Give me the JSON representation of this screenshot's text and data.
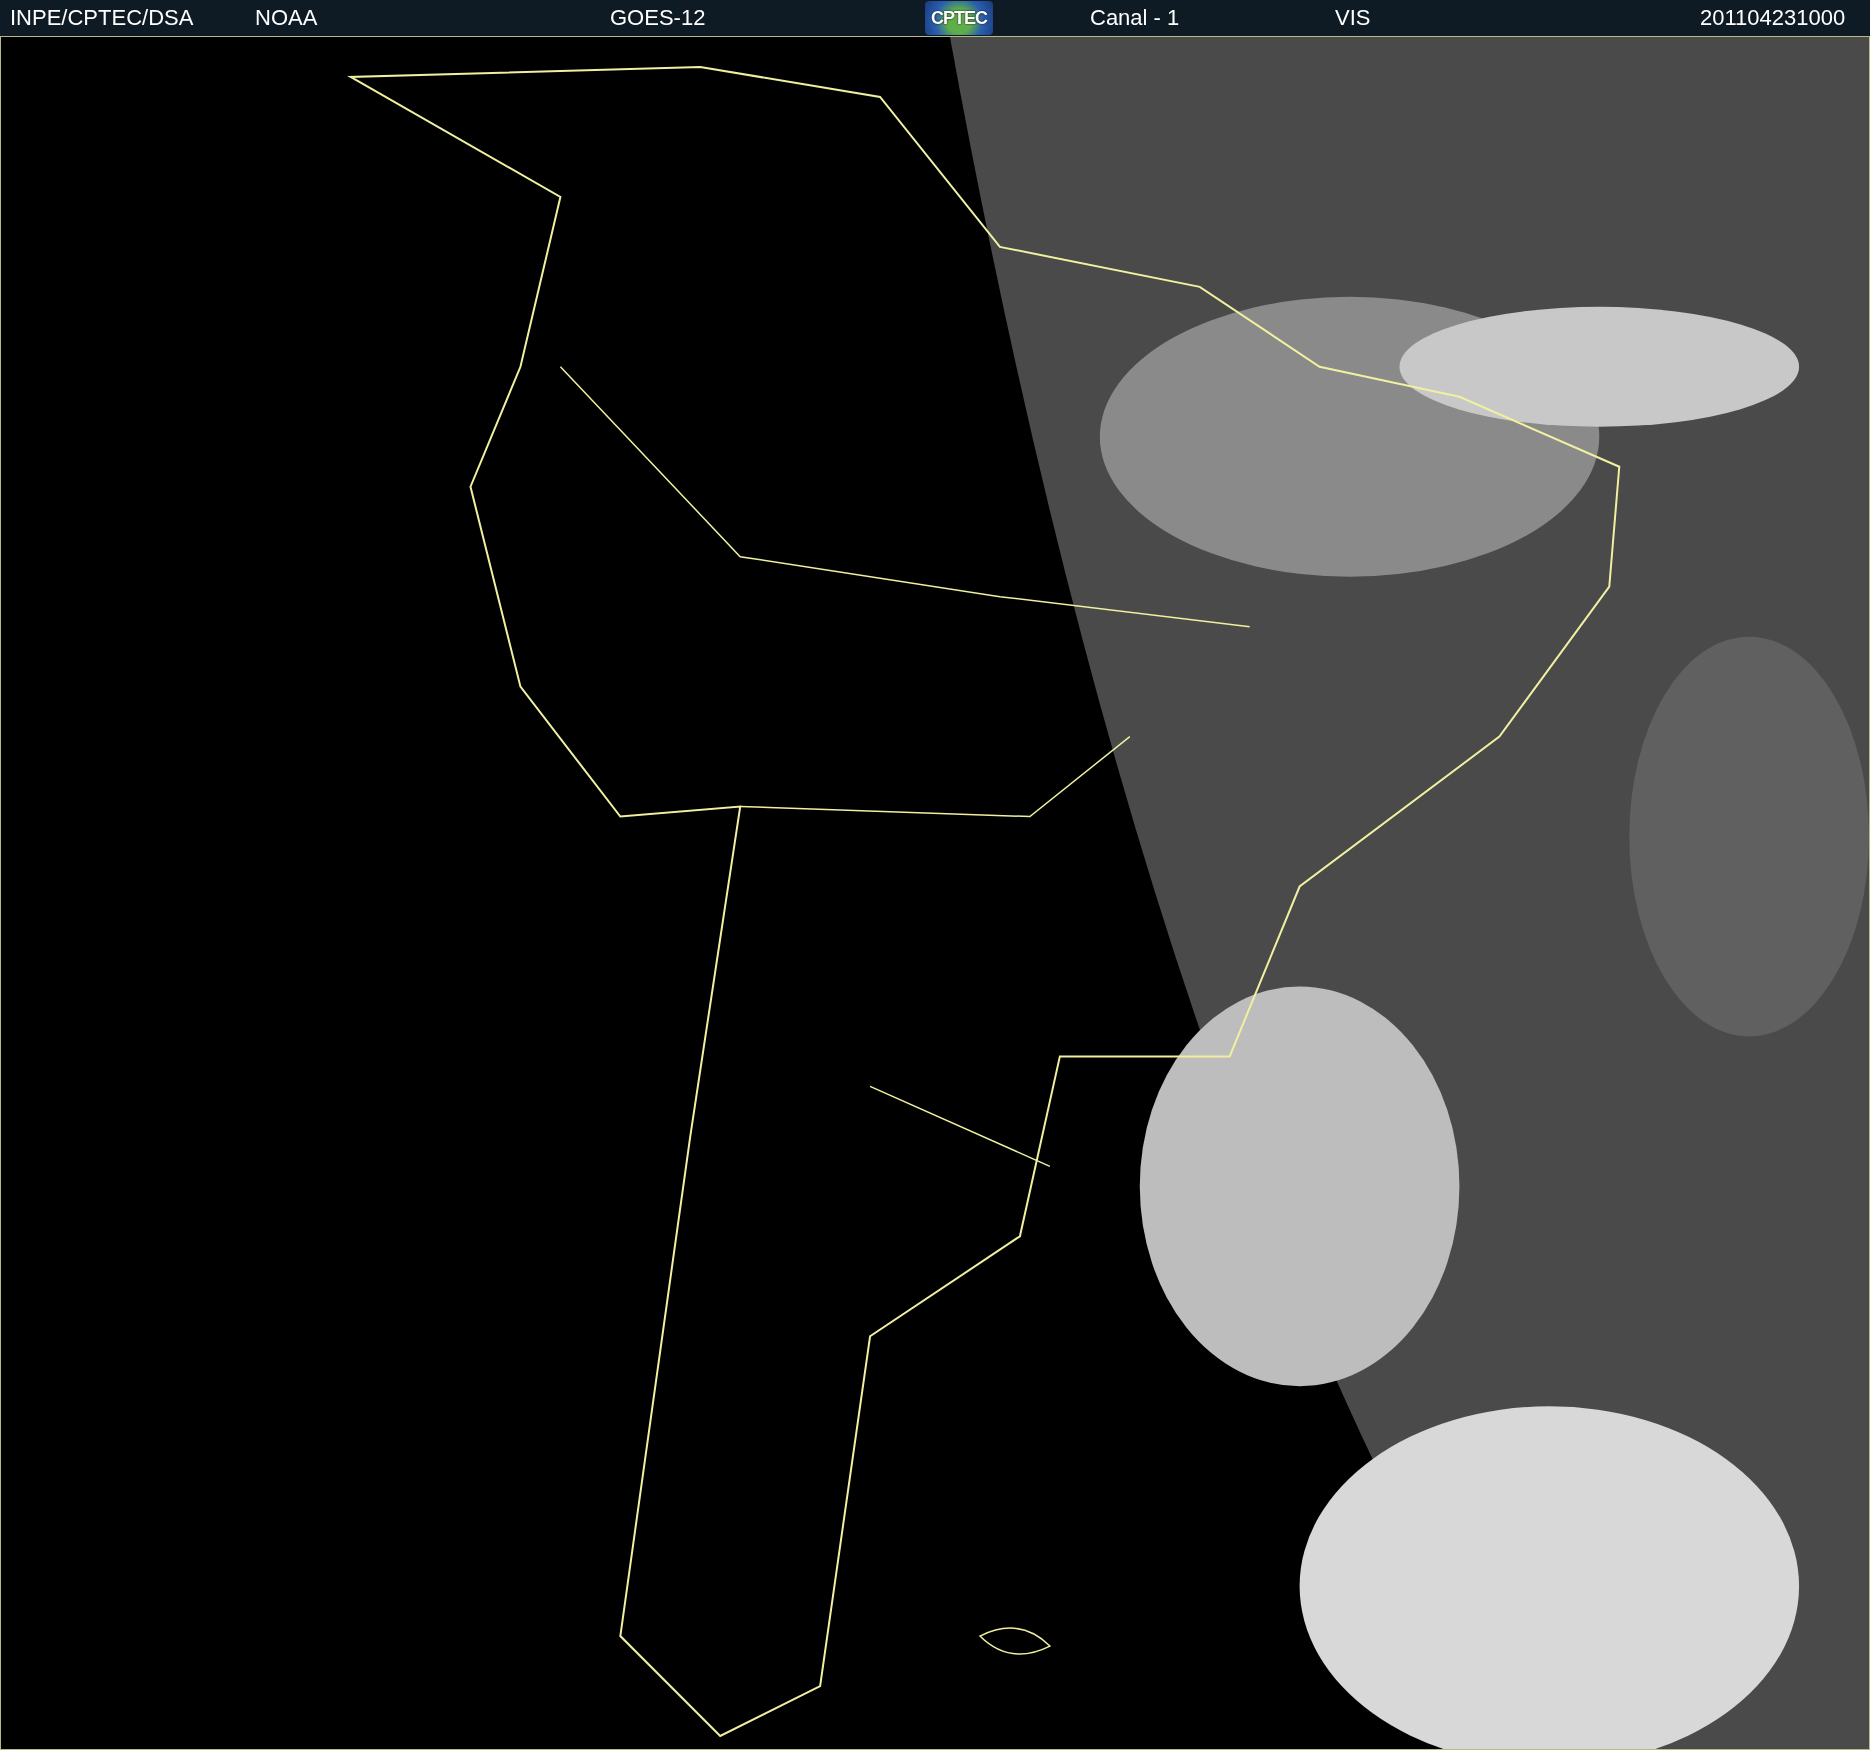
{
  "header": {
    "items": [
      "INPE/CPTEC/DSA",
      "NOAA",
      "GOES-12"
    ],
    "logo": "CPTEC",
    "channel": "Canal - 1",
    "band": "VIS",
    "timestamp": "201104231000"
  }
}
